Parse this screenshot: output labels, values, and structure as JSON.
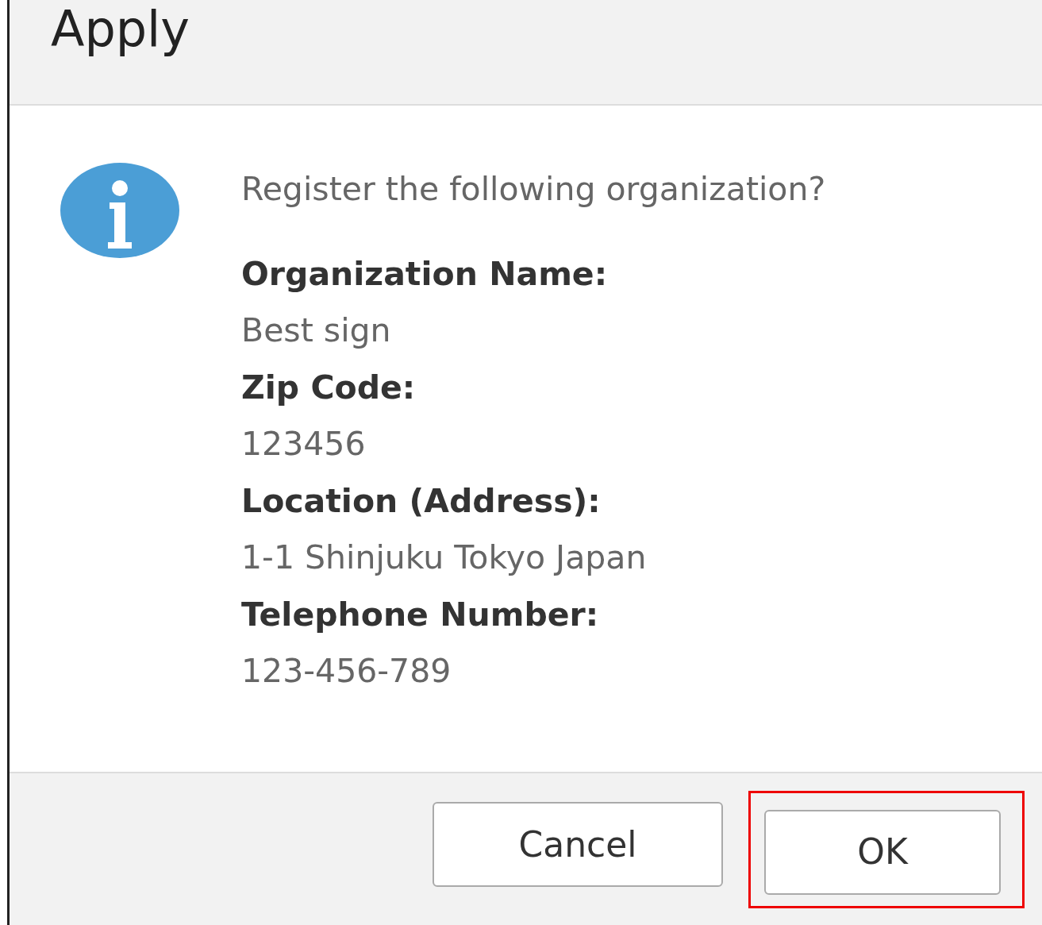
{
  "dialog": {
    "title": "Apply",
    "message": "Register the following organization?",
    "fields": [
      {
        "label": "Organization Name:",
        "value": "Best sign"
      },
      {
        "label": "Zip Code:",
        "value": "123456"
      },
      {
        "label": "Location (Address):",
        "value": "1-1 Shinjuku Tokyo Japan"
      },
      {
        "label": "Telephone Number:",
        "value": "123-456-789"
      }
    ],
    "buttons": [
      {
        "label": "Cancel",
        "highlighted": false
      },
      {
        "label": "OK",
        "highlighted": true
      }
    ]
  }
}
